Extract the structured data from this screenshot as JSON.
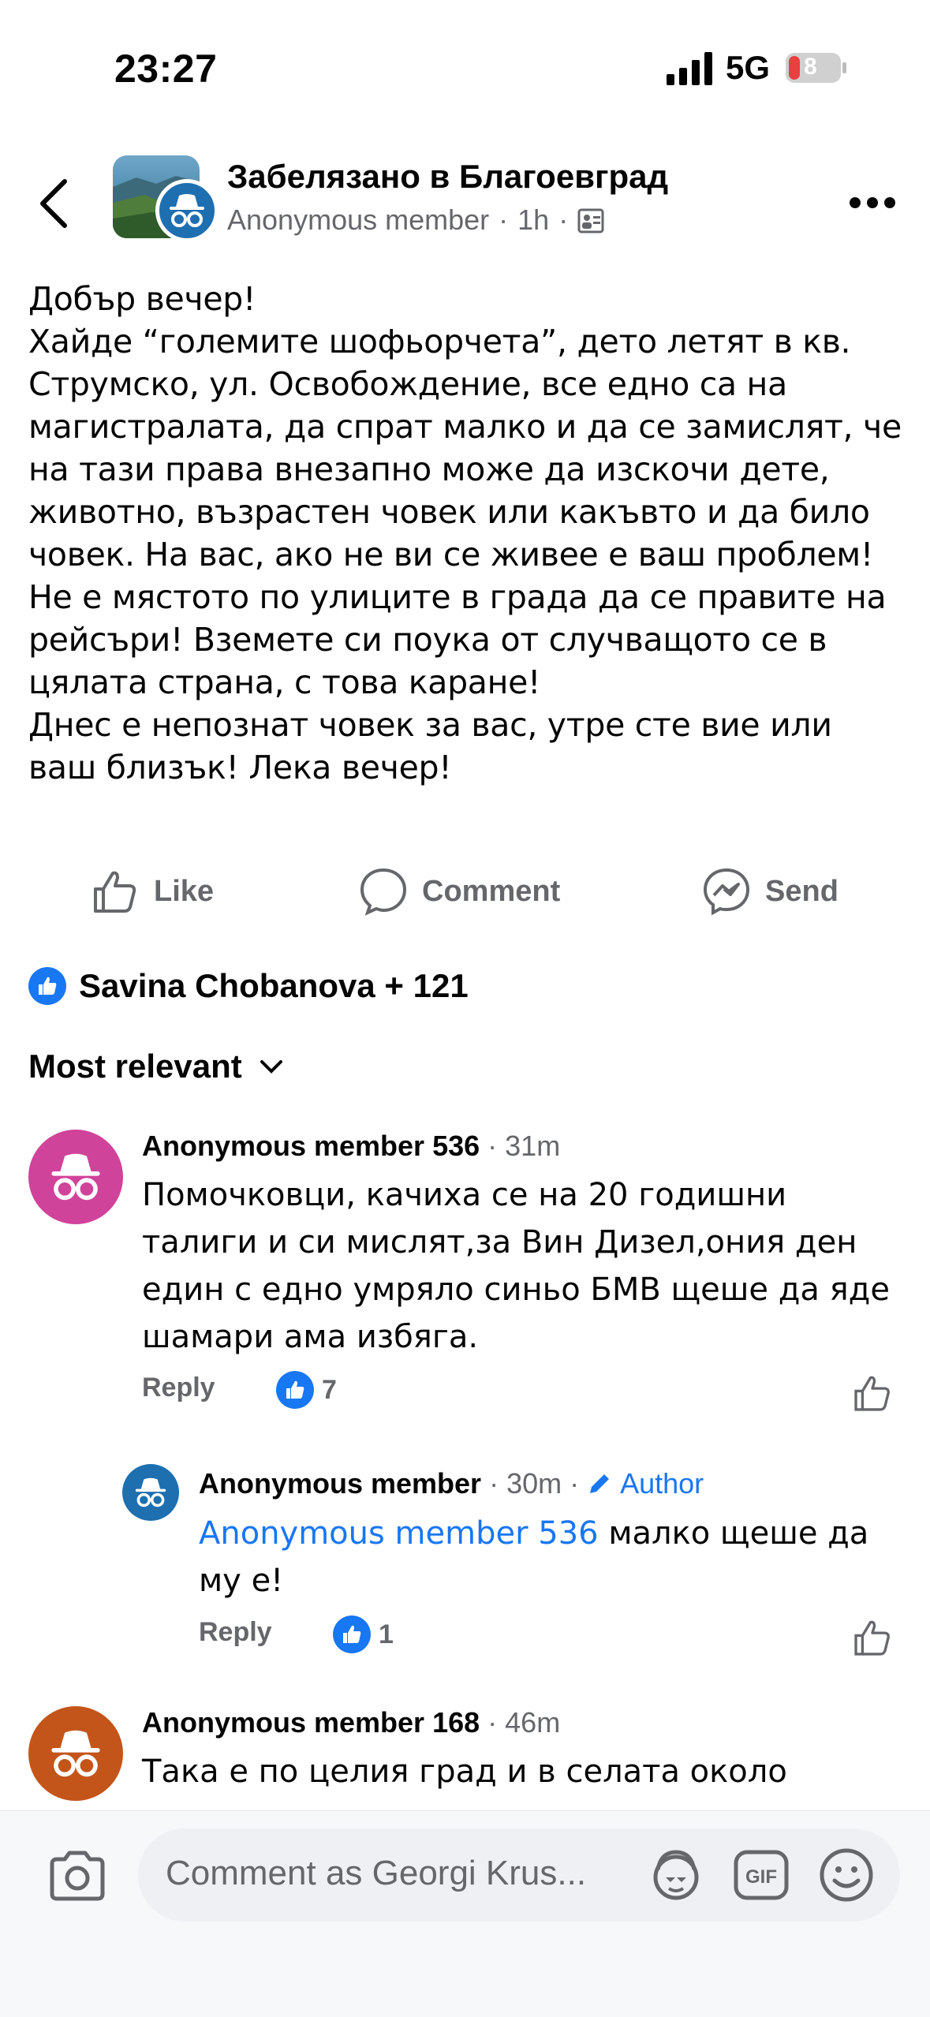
{
  "status_bar": {
    "time": "23:27",
    "network": "5G",
    "battery": "8"
  },
  "header": {
    "group_name": "Забелязано в Благоевград",
    "author": "Anonymous member",
    "separator": "·",
    "time": "1h"
  },
  "post": {
    "text": "Добър вечер!\nХайде “големите шофьорчета”, дето летят в кв. Струмско, ул. Освобождение, все едно са на магистралата, да спрат малко и да се замислят, че на тази права внезапно може да изскочи дете, животно, възрастен човек или какъвто и да било човек. На вас, ако не ви се живее е ваш проблем! Не е мястото по улиците в града да се правите на рейсъри! Вземете си поука от случващото се в цялата страна, с това каране!\nДнес е непознат човек за вас, утре сте вие или ваш близък! Лека вечер!"
  },
  "actions": {
    "like": "Like",
    "comment": "Comment",
    "send": "Send"
  },
  "reactions": {
    "summary": "Savina Chobanova + 121"
  },
  "sort": {
    "label": "Most relevant"
  },
  "comments": [
    {
      "name": "Anonymous member 536",
      "time": "· 31m",
      "text": "Помочковци, качиха се на 20 годишни талиги и си мислят,за Вин Дизел,ония ден един с едно умряло синьо БМВ щеше да яде шамари ама избяга.",
      "reply": "Reply",
      "likes": "7",
      "avatar_color": "#d0439a"
    },
    {
      "name": "Anonymous member",
      "time": "· 30m ·",
      "badge": "Author",
      "mention": "Anonymous member 536",
      "text": " малко щеше да му е!",
      "reply": "Reply",
      "likes": "1",
      "avatar_color": "#1e6fb0"
    },
    {
      "name": "Anonymous member 168",
      "time": "· 46m",
      "text": "Така е по целия град и в селата около",
      "avatar_color": "#c4551a"
    }
  ],
  "composer": {
    "placeholder": "Comment as Georgi Krus..."
  },
  "colors": {
    "accent": "#1877f2",
    "secondary_text": "#65676b"
  }
}
